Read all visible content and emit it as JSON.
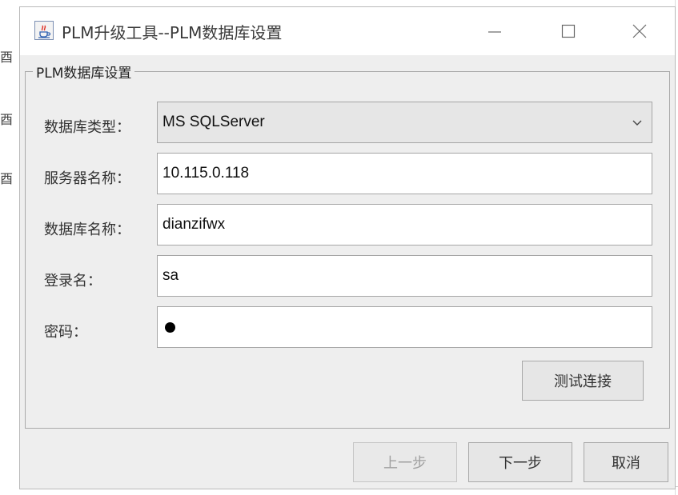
{
  "background": {
    "left_chars": [
      "酉",
      "酉",
      "酉"
    ]
  },
  "window": {
    "title": "PLM升级工具--PLM数据库设置",
    "app_icon": "java-cup-icon"
  },
  "group": {
    "title": "PLM数据库设置"
  },
  "fields": {
    "db_type": {
      "label": "数据库类型：",
      "value": "MS SQLServer"
    },
    "server_name": {
      "label": "服务器名称：",
      "value": "10.115.0.118"
    },
    "db_name": {
      "label": "数据库名称：",
      "value": "dianzifwx"
    },
    "login": {
      "label": "登录名：",
      "value": "sa"
    },
    "password": {
      "label": "密码：",
      "masked_char_count": 1
    }
  },
  "buttons": {
    "test": "测试连接",
    "prev": "上一步",
    "next": "下一步",
    "cancel": "取消"
  }
}
